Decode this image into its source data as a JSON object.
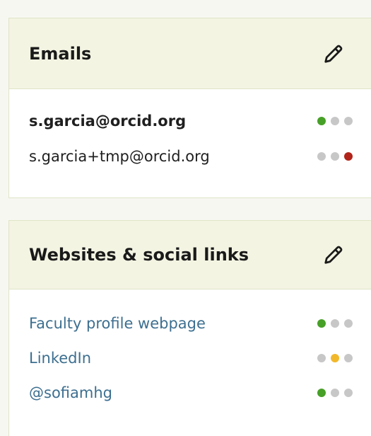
{
  "emails_section": {
    "title": "Emails",
    "items": [
      {
        "text": "s.garcia@orcid.org",
        "primary": true,
        "visibility_dots": [
          "#47a027",
          "#c7c7c7",
          "#c7c7c7"
        ]
      },
      {
        "text": "s.garcia+tmp@orcid.org",
        "primary": false,
        "visibility_dots": [
          "#c7c7c7",
          "#c7c7c7",
          "#b1241a"
        ]
      }
    ]
  },
  "websites_section": {
    "title": "Websites & social links",
    "items": [
      {
        "text": "Faculty profile webpage",
        "visibility_dots": [
          "#47a027",
          "#c7c7c7",
          "#c7c7c7"
        ]
      },
      {
        "text": "LinkedIn",
        "visibility_dots": [
          "#c7c7c7",
          "#f2b82c",
          "#c7c7c7"
        ]
      },
      {
        "text": "@sofiamhg",
        "visibility_dots": [
          "#47a027",
          "#c7c7c7",
          "#c7c7c7"
        ]
      }
    ]
  },
  "icons": {
    "edit": "pencil-icon",
    "visibility": "visibility-dots-icon"
  },
  "colors": {
    "header_bg": "#f4f4e3",
    "border": "#dfe5c6",
    "link": "#3d6f90",
    "visibility_everyone": "#47a027",
    "visibility_trusted": "#f2b82c",
    "visibility_private": "#b1241a",
    "visibility_inactive": "#c7c7c7"
  }
}
